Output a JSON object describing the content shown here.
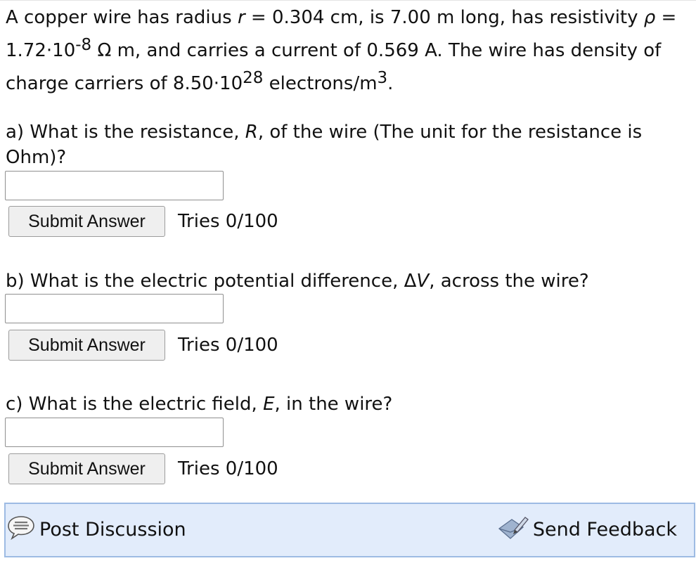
{
  "problem": {
    "l1_a": "A copper wire has radius ",
    "l1_var": "r",
    "l1_b": " = 0.304 cm, is 7.00 m long, has resistivity ",
    "rho_var": "ρ",
    "rho_value": " = 1.72·10",
    "rho_exp": "-8",
    "rho_unit": " Ω m, and carries a current of 0.569 A. The wire has density of charge carriers of 8.50·10",
    "density_exp": "28",
    "density_unit": " electrons/m",
    "density_unit_exp": "3",
    "end": "."
  },
  "questions": [
    {
      "pre": "a) What is the resistance, ",
      "var": "R",
      "post": ", of the wire (The unit for the resistance is Ohm)?",
      "input_value": "",
      "submit_label": "Submit Answer",
      "tries": "Tries 0/100"
    },
    {
      "pre": "b) What is the electric potential difference, Δ",
      "var": "V",
      "post": ", across the wire?",
      "input_value": "",
      "submit_label": "Submit Answer",
      "tries": "Tries 0/100"
    },
    {
      "pre": "c) What is the electric field, ",
      "var": "E",
      "post": ", in the wire?",
      "input_value": "",
      "submit_label": "Submit Answer",
      "tries": "Tries 0/100"
    }
  ],
  "footer": {
    "post_discussion": "Post Discussion",
    "send_feedback": "Send Feedback",
    "post_icon": "speech-bubble-icon",
    "feedback_icon": "pencil-envelope-icon",
    "bar_bg": "#e2ecfb",
    "bar_border": "#9dbbe3"
  }
}
